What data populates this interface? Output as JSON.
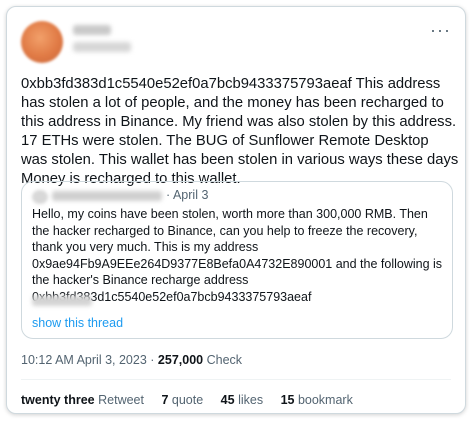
{
  "tweet": {
    "text": "0xbb3fd383d1c5540e52ef0a7bcb9433375793aeaf This address has stolen a lot of people, and the money has been recharged to this address in Binance. My friend was also stolen by this address. 17 ETHs were stolen. The BUG of Sunflower Remote Desktop was stolen. This wallet has been stolen in various ways these days Money is recharged to this wallet.",
    "more_icon": "···",
    "timestamp": "10:12 AM April 3, 2023",
    "separator": "·",
    "views_count": "257,000",
    "views_label": "Check"
  },
  "quote": {
    "date": "April 3",
    "text": "Hello, my coins have been stolen, worth more than 300,000 RMB. Then the hacker recharged to Binance, can you help to freeze the recovery, thank you very much. This is my address 0x9ae94Fb9A9EEe264D9377E8Befa0A4732E890001 and the following is the hacker's Binance recharge address 0xbb3fd383d1c5540e52ef0a7bcb9433375793aeaf",
    "show_thread": "show this thread"
  },
  "stats": {
    "retweets_count": "twenty three",
    "retweets_label": "Retweet",
    "quotes_count": "7",
    "quotes_label": "quote",
    "likes_count": "45",
    "likes_label": "likes",
    "bookmarks_count": "15",
    "bookmarks_label": "bookmark"
  }
}
